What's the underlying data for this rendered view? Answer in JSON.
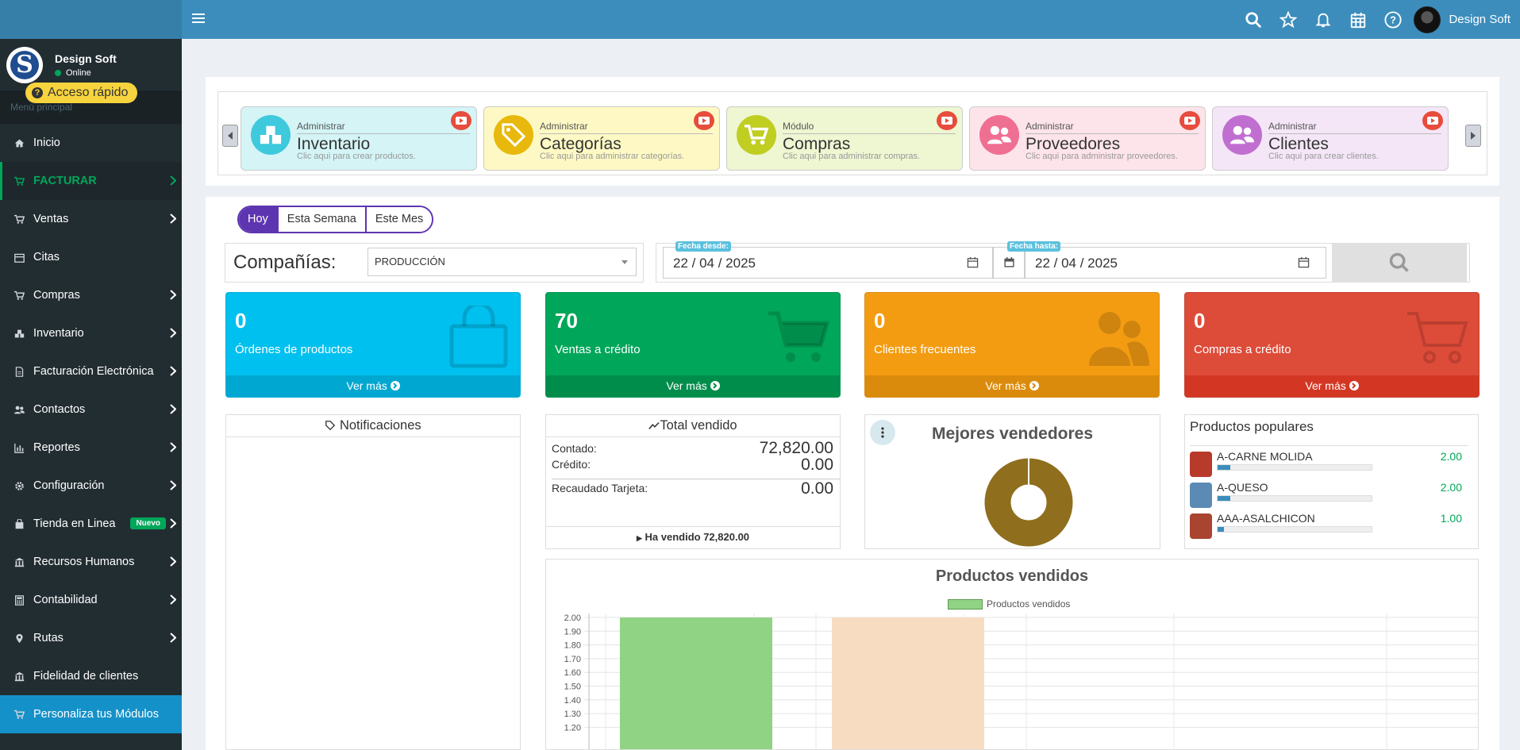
{
  "header": {
    "user_name": "Design Soft",
    "icons": [
      "search-icon",
      "star-icon",
      "bell-icon",
      "calendar-icon",
      "help-icon"
    ]
  },
  "sidebar": {
    "user_name": "Design Soft",
    "status": "Online",
    "menu_header": "Menú principal",
    "items": [
      {
        "label": "Inicio",
        "icon": "home-icon"
      },
      {
        "label": "FACTURAR",
        "icon": "cart-icon"
      },
      {
        "label": "Ventas",
        "icon": "cart-icon"
      },
      {
        "label": "Citas",
        "icon": "calendar-icon"
      },
      {
        "label": "Compras",
        "icon": "cart-icon"
      },
      {
        "label": "Inventario",
        "icon": "cubes-icon"
      },
      {
        "label": "Facturación Electrónica",
        "icon": "file-icon"
      },
      {
        "label": "Contactos",
        "icon": "users-icon"
      },
      {
        "label": "Reportes",
        "icon": "bar-chart-icon"
      },
      {
        "label": "Configuración",
        "icon": "gear-icon"
      },
      {
        "label": "Tienda en Linea",
        "icon": "bag-icon",
        "badge": "Nuevo"
      },
      {
        "label": "Recursos Humanos",
        "icon": "bank-icon"
      },
      {
        "label": "Contabilidad",
        "icon": "calculator-icon"
      },
      {
        "label": "Rutas",
        "icon": "map-marker-icon"
      },
      {
        "label": "Fidelidad de clientes",
        "icon": "bank-icon"
      },
      {
        "label": "Personaliza tus Módulos",
        "icon": "cart-icon"
      }
    ]
  },
  "quick_access": {
    "title": "Acceso rápido",
    "cards": [
      {
        "small": "Administrar",
        "big": "Inventario",
        "desc": "Clic aqui para crear productos.",
        "color": "#d4f4f6",
        "circle": "#3ec9dc",
        "icon": "cubes-icon"
      },
      {
        "small": "Administrar",
        "big": "Categorías",
        "desc": "Clic aqui para administrar categorías.",
        "color": "#fef9c4",
        "circle": "#e8b90c",
        "icon": "tags-icon"
      },
      {
        "small": "Módulo",
        "big": "Compras",
        "desc": "Clic aqui para administrar compras.",
        "color": "#eef6d2",
        "circle": "#c0ce21",
        "icon": "cart-icon"
      },
      {
        "small": "Administrar",
        "big": "Proveedores",
        "desc": "Clic aqui para administrar proveedores.",
        "color": "#fde4ea",
        "circle": "#ef6f93",
        "icon": "users-icon"
      },
      {
        "small": "Administrar",
        "big": "Clientes",
        "desc": "Clic aqui para crear clientes.",
        "color": "#f4e6f7",
        "circle": "#c06fd1",
        "icon": "users-icon"
      }
    ]
  },
  "filters": {
    "periods": [
      "Hoy",
      "Esta Semana",
      "Este Mes"
    ],
    "selected_period": "Hoy",
    "company_label": "Compañías:",
    "company_value": "PRODUCCIÓN",
    "from_label": "Fecha desde:",
    "from_value": "22 / 04 / 2025",
    "to_label": "Fecha hasta:",
    "to_value": "22 / 04 / 2025"
  },
  "stats": [
    {
      "value": "0",
      "label": "Órdenes de productos",
      "footer": "Ver más",
      "color": "#00c0ef",
      "foot": "#00a7d0",
      "icon": "shopping-bag-icon"
    },
    {
      "value": "70",
      "label": "Ventas a crédito",
      "footer": "Ver más",
      "color": "#00a65a",
      "foot": "#008d4c",
      "icon": "cart-icon"
    },
    {
      "value": "0",
      "label": "Clientes frecuentes",
      "footer": "Ver más",
      "color": "#f39c12",
      "foot": "#db8b0b",
      "icon": "users-icon"
    },
    {
      "value": "0",
      "label": "Compras a crédito",
      "footer": "Ver más",
      "color": "#dd4b39",
      "foot": "#d33724",
      "icon": "cart-icon"
    }
  ],
  "notifications": {
    "title": "Notificaciones"
  },
  "total_sold": {
    "title": "Total vendido",
    "cash_label": "Contado:",
    "cash_value": "72,820.00",
    "credit_label": "Crédito:",
    "credit_value": "0.00",
    "card_label": "Recaudado Tarjeta:",
    "card_value": "0.00",
    "footer": "Ha vendido 72,820.00"
  },
  "best_sellers": {
    "title": "Mejores vendedores",
    "donut_color": "#8f6e1d"
  },
  "popular": {
    "title": "Productos populares",
    "items": [
      {
        "name": "A-CARNE MOLIDA",
        "value": "2.00",
        "fraction": 0.08,
        "thumb": "#b83a2a"
      },
      {
        "name": "A-QUESO",
        "value": "2.00",
        "fraction": 0.08,
        "thumb": "#5b8ab5"
      },
      {
        "name": "AAA-ASALCHICON",
        "value": "1.00",
        "fraction": 0.04,
        "thumb": "#a8442f"
      }
    ]
  },
  "chart_data": {
    "type": "bar",
    "title": "Productos vendidos",
    "categories": [
      "",
      ""
    ],
    "series": [
      {
        "name": "Productos vendidos",
        "values": [
          2.0,
          2.0
        ]
      }
    ],
    "bar_colors": [
      "#90d385",
      "#f8dcc2"
    ],
    "y_ticks": [
      "2.00",
      "1.90",
      "1.80",
      "1.70",
      "1.60",
      "1.50",
      "1.40",
      "1.30",
      "1.20"
    ],
    "ylim": [
      1.2,
      2.0
    ],
    "grid": true,
    "legend": "top"
  }
}
